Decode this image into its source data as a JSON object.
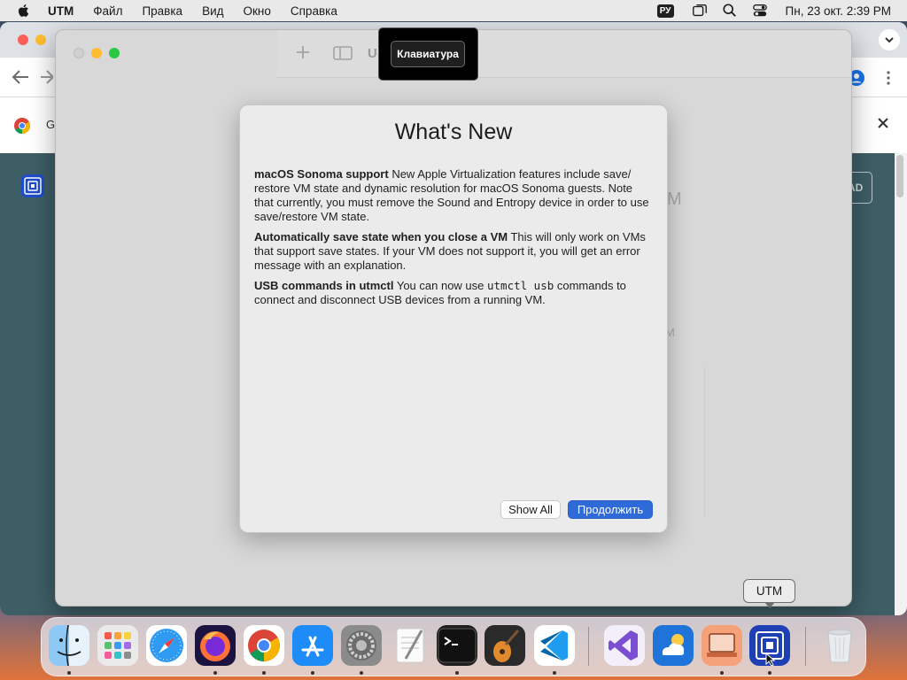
{
  "menubar": {
    "app_name": "UTM",
    "menus": [
      "Файл",
      "Правка",
      "Вид",
      "Окно",
      "Справка"
    ],
    "input_source": "РУ",
    "clock": "Пн, 23 окт.  2:39 PM"
  },
  "browser": {
    "infobar_text": "G",
    "side_button_text": "AD"
  },
  "utm_window": {
    "title_fragment": "U",
    "ghost_text_1": "M",
    "ghost_text_2": "M"
  },
  "keyboard_tooltip": {
    "label": "Клавиатура"
  },
  "whats_new": {
    "title": "What's New",
    "items": [
      {
        "heading": "macOS Sonoma support",
        "text": " New Apple Virtualization features include save/ restore VM state and dynamic resolution for macOS Sonoma guests. Note that currently, you must remove the Sound and Entropy device in order to use save/restore VM state."
      },
      {
        "heading": "Automatically save state when you close a VM",
        "text": " This will only work on VMs that support save states. If your VM does not support it, you will get an error message with an explanation."
      },
      {
        "heading": "USB commands in utmctl",
        "text_before": " You can now use ",
        "code": "utmctl usb",
        "text_after": " commands to connect and disconnect USB devices from a running VM."
      }
    ],
    "show_all_label": "Show All",
    "continue_label": "Продолжить"
  },
  "dock": {
    "tooltip": "UTM",
    "apps": [
      {
        "name": "Finder",
        "icon": "finder-icon",
        "running": true
      },
      {
        "name": "Launchpad",
        "icon": "launchpad-icon",
        "running": false
      },
      {
        "name": "Safari",
        "icon": "safari-icon",
        "running": false
      },
      {
        "name": "Firefox",
        "icon": "firefox-icon",
        "running": true
      },
      {
        "name": "Google Chrome",
        "icon": "chrome-icon",
        "running": true
      },
      {
        "name": "App Store",
        "icon": "app-store-icon",
        "running": true
      },
      {
        "name": "System Settings",
        "icon": "system-settings-icon",
        "running": true
      },
      {
        "name": "TextEdit",
        "icon": "textedit-icon",
        "running": false
      },
      {
        "name": "Terminal",
        "icon": "terminal-icon",
        "running": true
      },
      {
        "name": "GarageBand",
        "icon": "garageband-icon",
        "running": false
      },
      {
        "name": "Visual Studio Code",
        "icon": "vscode-icon",
        "running": true
      },
      {
        "name": "Visual Studio",
        "icon": "visual-studio-icon",
        "running": false
      },
      {
        "name": "iCloud Weather",
        "icon": "weather-icon",
        "running": false
      },
      {
        "name": "Remote Desktop",
        "icon": "remote-desktop-icon",
        "running": true
      },
      {
        "name": "UTM",
        "icon": "utm-icon",
        "running": true
      },
      {
        "name": "Trash",
        "icon": "trash-icon",
        "running": false
      }
    ]
  },
  "colors": {
    "accent": "#2f6ad9",
    "menubar_bg": "#e9e9ea",
    "dialog_bg": "#ebebeb"
  }
}
